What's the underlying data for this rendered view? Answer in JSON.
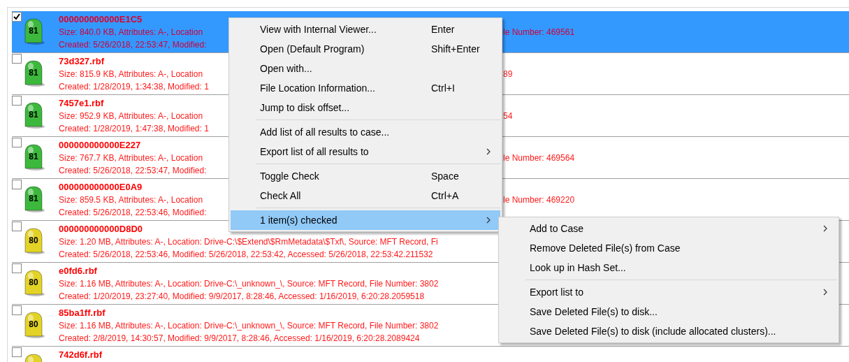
{
  "results": [
    {
      "checked": true,
      "selected": true,
      "score": "81",
      "color": "#3cb93c",
      "name": "000000000000E1C5",
      "size": "Size: 840.0 KB, Attributes: A-, Location",
      "size_tail": "le Number: 469561",
      "created": "Created: 5/26/2018, 22:53:47, Modified:"
    },
    {
      "checked": false,
      "selected": false,
      "score": "81",
      "color": "#3cb93c",
      "name": "73d327.rbf",
      "size": "Size: 815.9 KB, Attributes: A-, Location",
      "size_tail": "89",
      "created": "Created: 1/28/2019, 1:34:38, Modified: 1"
    },
    {
      "checked": false,
      "selected": false,
      "score": "81",
      "color": "#3cb93c",
      "name": "7457e1.rbf",
      "size": "Size: 952.9 KB, Attributes: A-, Location",
      "size_tail": "54",
      "created": "Created: 1/28/2019, 1:47:38, Modified: 1"
    },
    {
      "checked": false,
      "selected": false,
      "score": "81",
      "color": "#3cb93c",
      "name": "000000000000E227",
      "size": "Size: 767.7 KB, Attributes: A-, Location",
      "size_tail": "le Number: 469564",
      "created": "Created: 5/26/2018, 22:53:47, Modified:"
    },
    {
      "checked": false,
      "selected": false,
      "score": "81",
      "color": "#3cb93c",
      "name": "000000000000E0A9",
      "size": "Size: 859.5 KB, Attributes: A-, Location",
      "size_tail": "le Number: 469220",
      "created": "Created: 5/26/2018, 22:53:46, Modified:"
    },
    {
      "checked": false,
      "selected": false,
      "score": "80",
      "color": "#e3d327",
      "name": "000000000000D8D0",
      "size": "Size: 1.20 MB, Attributes: A-, Location: Drive-C:\\$Extend\\$RmMetadata\\$Txf\\, Source: MFT Record, Fi",
      "created": "Created: 5/26/2018, 22:53:46, Modified: 5/26/2018, 22:53:42, Accessed: 5/26/2018, 22:53:42.211532"
    },
    {
      "checked": false,
      "selected": false,
      "score": "80",
      "color": "#e3d327",
      "name": "e0fd6.rbf",
      "size": "Size: 1.16 MB, Attributes: A-, Location: Drive-C:\\_unknown_\\, Source: MFT Record, File Number: 3802",
      "created": "Created: 1/20/2019, 23:27:40, Modified: 9/9/2017, 8:28:46, Accessed: 1/16/2019, 6:20:28.2059518"
    },
    {
      "checked": false,
      "selected": false,
      "score": "80",
      "color": "#e3d327",
      "name": "85ba1ff.rbf",
      "size": "Size: 1.16 MB, Attributes: A-, Location: Drive-C:\\_unknown_\\, Source: MFT Record, File Number: 3802",
      "created": "Created: 2/8/2019, 14:30:57, Modified: 9/9/2017, 8:28:46, Accessed: 1/16/2019, 6:20:28.2089424"
    },
    {
      "checked": false,
      "selected": false,
      "color": "#e3d327",
      "name": "742d6f.rbf"
    }
  ],
  "context_menu": [
    {
      "kind": "item",
      "label": "View with Internal Viewer...",
      "shortcut": "Enter",
      "selected": false
    },
    {
      "kind": "item",
      "label": "Open (Default Program)",
      "shortcut": "Shift+Enter",
      "selected": false
    },
    {
      "kind": "item",
      "label": "Open with...",
      "selected": false
    },
    {
      "kind": "item",
      "label": "File Location Information...",
      "shortcut": "Ctrl+I",
      "selected": false
    },
    {
      "kind": "item",
      "label": "Jump to disk offset...",
      "selected": false
    },
    {
      "kind": "separator"
    },
    {
      "kind": "item",
      "label": "Add list of all results to case...",
      "selected": false
    },
    {
      "kind": "submenu",
      "label": "Export list of all results to",
      "selected": false
    },
    {
      "kind": "separator"
    },
    {
      "kind": "item",
      "label": "Toggle Check",
      "shortcut": "Space",
      "selected": false
    },
    {
      "kind": "item",
      "label": "Check All",
      "shortcut": "Ctrl+A",
      "selected": false
    },
    {
      "kind": "separator"
    },
    {
      "kind": "submenu",
      "label": "1 item(s) checked",
      "selected": true
    }
  ],
  "submenu": [
    {
      "kind": "submenu",
      "label": "Add to Case"
    },
    {
      "kind": "item",
      "label": "Remove Deleted File(s) from Case"
    },
    {
      "kind": "item",
      "label": "Look up in Hash Set..."
    },
    {
      "kind": "separator"
    },
    {
      "kind": "submenu",
      "label": "Export list to"
    },
    {
      "kind": "item",
      "label": "Save Deleted File(s) to disk..."
    },
    {
      "kind": "item",
      "label": "Save Deleted File(s) to disk (include allocated clusters)..."
    }
  ]
}
